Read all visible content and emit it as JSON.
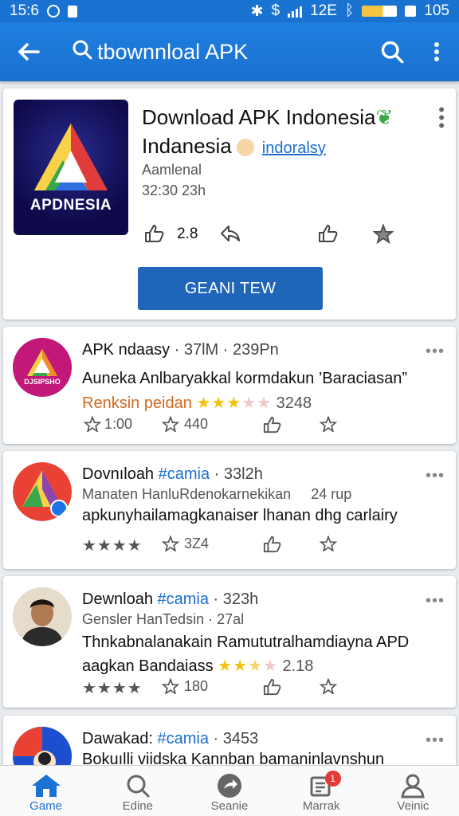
{
  "status_bar": {
    "time": "15:6",
    "network": "12E",
    "battery": "105"
  },
  "appbar": {
    "search_text": "tbownnloal APK",
    "icons": [
      "back-arrow-icon",
      "search-icon",
      "more-vert-icon"
    ]
  },
  "app_card": {
    "logo_text": "APDNESIA",
    "title_line1": "Download APK Indonesia",
    "title_line2": "Indanesia",
    "link": "indoralsy",
    "meta1": "Aamlenal",
    "meta2": "32:30 23h",
    "like_count": "2.8",
    "cta_label": "GEANI TEW"
  },
  "posts": [
    {
      "title": "APK ndaasy",
      "meta": " · 37lM · 239Pn",
      "line1": "Auneka Anlbaryakkal kormdakun ’Baraciasan”",
      "line2_text": "Renksin peidan",
      "line2_num": "3248",
      "rating": 3,
      "actions": [
        "1:00",
        "440"
      ],
      "avatar_text": "DJSIPSHO"
    },
    {
      "title": "Dovnıloah",
      "tag": "#camia",
      "meta": " · 33l2h",
      "line1": "Manaten HanluRdenokarnekikan",
      "line1_right": "24 rup",
      "line2": "apkunyhailamagkanaiser lhanan dhg carlairy",
      "rating": 4,
      "actions": [
        "3Z4"
      ]
    },
    {
      "title": "Dewnloah",
      "tag": "#camia",
      "meta": " · 323h",
      "line1": "Gensler HanTedsin · 27al",
      "line2": "Thnkabnalanakain Ramututralhamdiayna APD",
      "line3_text": "aagkan Bandaiass",
      "line3_num": "2.18",
      "rating": 4,
      "actions": [
        "180"
      ]
    },
    {
      "title": "Dawakad:",
      "tag": "#camia",
      "meta": " · 3453",
      "line1": "Bokuılli viidska Kannban bamaninlavnshun"
    }
  ],
  "bottom_nav": [
    {
      "label": "Game",
      "icon": "home-icon",
      "active": true
    },
    {
      "label": "Edine",
      "icon": "search-icon",
      "active": false
    },
    {
      "label": "Seanie",
      "icon": "share-circle-icon",
      "active": false
    },
    {
      "label": "Marrak",
      "icon": "notes-icon",
      "active": false,
      "badge": "1"
    },
    {
      "label": "Veinic",
      "icon": "person-icon",
      "active": false
    }
  ],
  "colors": {
    "primary": "#1a73d1",
    "cta": "#1f66b8",
    "link": "#1a6fd0",
    "star": "#f4c20d",
    "accent_orange": "#d2691e"
  }
}
